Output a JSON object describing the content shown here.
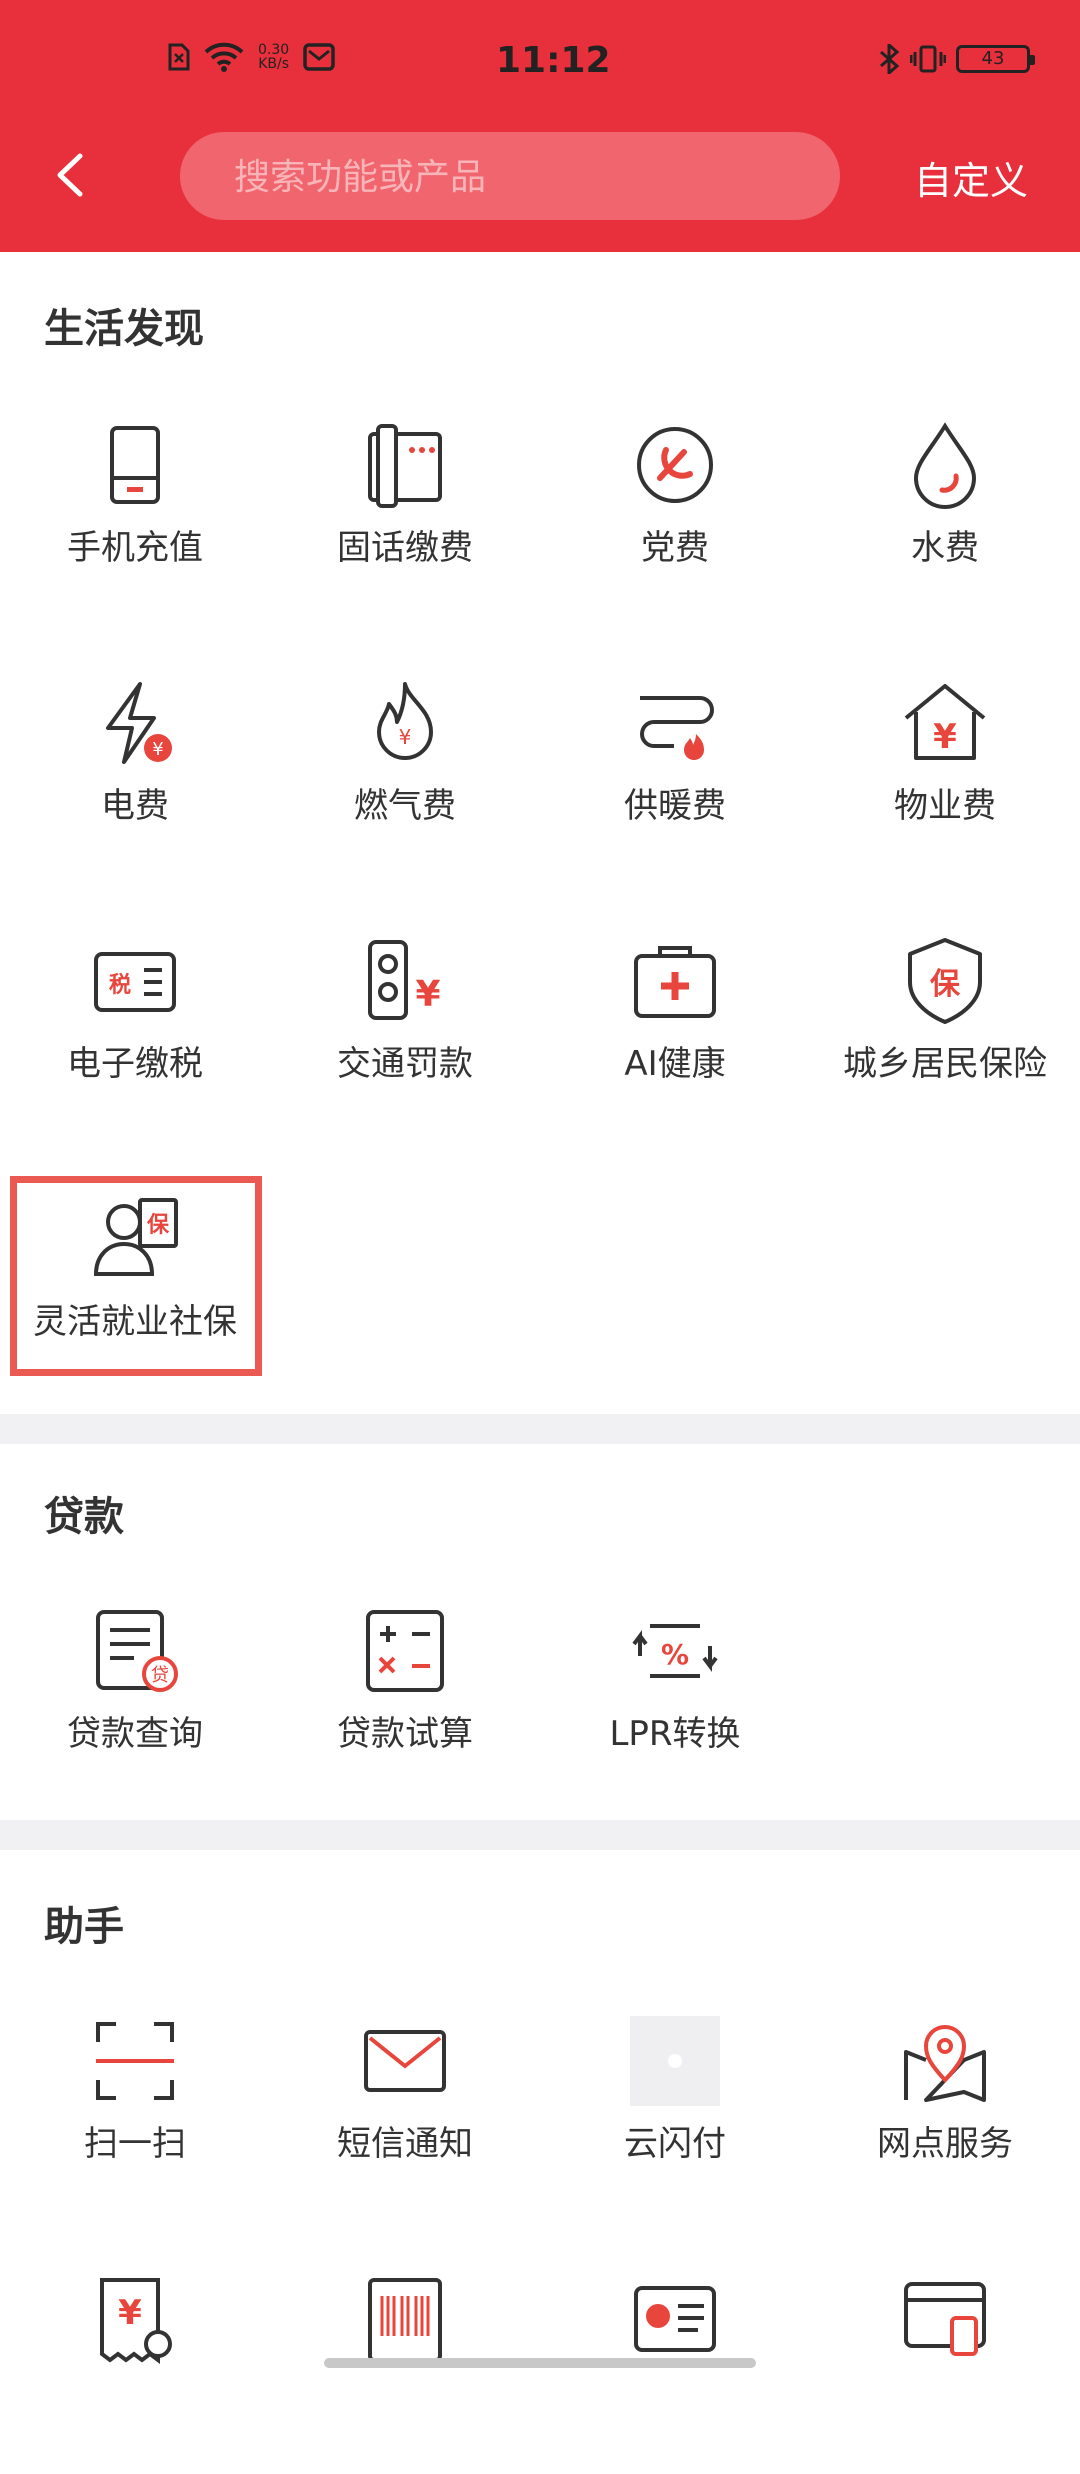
{
  "status_bar": {
    "time": "11:12",
    "net_speed": "0.30",
    "net_unit": "KB/s",
    "battery": "43"
  },
  "header": {
    "search_placeholder": "搜索功能或产品",
    "customize_label": "自定义"
  },
  "sections": {
    "life": {
      "title": "生活发现",
      "items": [
        {
          "label": "手机充值",
          "icon": "phone-icon"
        },
        {
          "label": "固话缴费",
          "icon": "landline-icon"
        },
        {
          "label": "党费",
          "icon": "party-emblem-icon"
        },
        {
          "label": "水费",
          "icon": "water-drop-icon"
        },
        {
          "label": "电费",
          "icon": "lightning-icon"
        },
        {
          "label": "燃气费",
          "icon": "flame-icon"
        },
        {
          "label": "供暖费",
          "icon": "heating-icon"
        },
        {
          "label": "物业费",
          "icon": "house-yen-icon"
        },
        {
          "label": "电子缴税",
          "icon": "tax-icon"
        },
        {
          "label": "交通罚款",
          "icon": "traffic-light-icon"
        },
        {
          "label": "AI健康",
          "icon": "medical-kit-icon"
        },
        {
          "label": "城乡居民保险",
          "icon": "shield-icon"
        },
        {
          "label": "灵活就业社保",
          "icon": "person-insurance-icon"
        }
      ]
    },
    "loan": {
      "title": "贷款",
      "items": [
        {
          "label": "贷款查询",
          "icon": "loan-doc-icon"
        },
        {
          "label": "贷款试算",
          "icon": "calculator-icon"
        },
        {
          "label": "LPR转换",
          "icon": "percent-exchange-icon"
        }
      ]
    },
    "assistant": {
      "title": "助手",
      "items": [
        {
          "label": "扫一扫",
          "icon": "scan-icon"
        },
        {
          "label": "短信通知",
          "icon": "mail-icon"
        },
        {
          "label": "云闪付",
          "icon": "cloud-pay-icon"
        },
        {
          "label": "网点服务",
          "icon": "map-pin-icon"
        }
      ],
      "partial_icons": [
        "yen-receipt-icon",
        "barcode-icon",
        "card-icon",
        "window-phone-icon"
      ]
    }
  },
  "colors": {
    "brand": "#e8303c",
    "accent": "#e8453c",
    "highlight": "#ea5a52"
  }
}
